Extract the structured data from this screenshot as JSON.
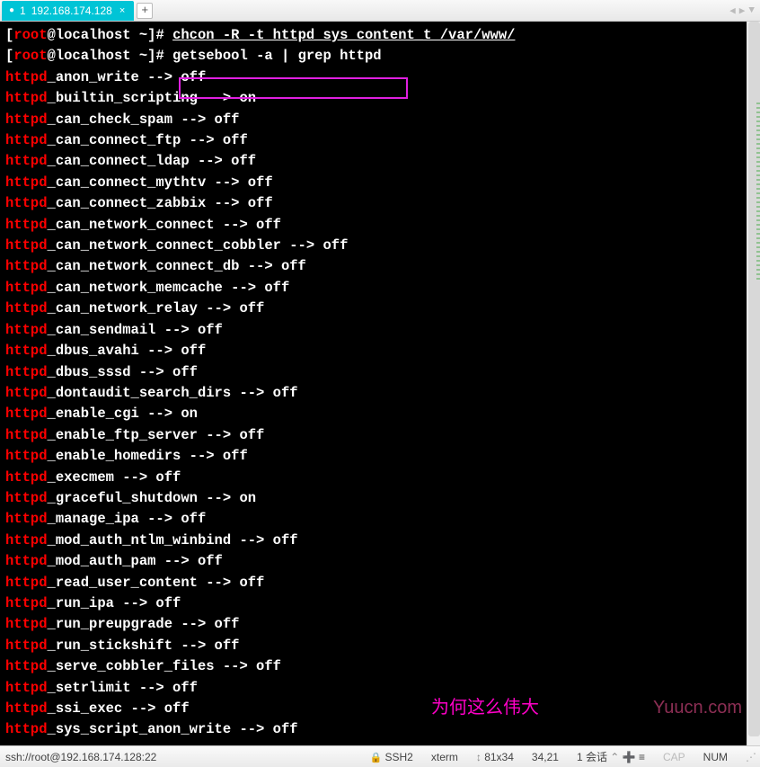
{
  "tab": {
    "index": "1",
    "title": "192.168.174.128",
    "close": "×",
    "add": "+"
  },
  "nav": {
    "left": "◀",
    "right": "▶",
    "down": "▼"
  },
  "prompt": {
    "user": "root",
    "host": "localhost",
    "dir": "~",
    "symbol": "#"
  },
  "cmd1": "chcon -R -t httpd_sys_content_t /var/www/",
  "cmd2": "getsebool -a | grep httpd",
  "booleans": [
    {
      "name": "_anon_write",
      "val": "off"
    },
    {
      "name": "_builtin_scripting",
      "val": "on"
    },
    {
      "name": "_can_check_spam",
      "val": "off"
    },
    {
      "name": "_can_connect_ftp",
      "val": "off"
    },
    {
      "name": "_can_connect_ldap",
      "val": "off"
    },
    {
      "name": "_can_connect_mythtv",
      "val": "off"
    },
    {
      "name": "_can_connect_zabbix",
      "val": "off"
    },
    {
      "name": "_can_network_connect",
      "val": "off"
    },
    {
      "name": "_can_network_connect_cobbler",
      "val": "off"
    },
    {
      "name": "_can_network_connect_db",
      "val": "off"
    },
    {
      "name": "_can_network_memcache",
      "val": "off"
    },
    {
      "name": "_can_network_relay",
      "val": "off"
    },
    {
      "name": "_can_sendmail",
      "val": "off"
    },
    {
      "name": "_dbus_avahi",
      "val": "off"
    },
    {
      "name": "_dbus_sssd",
      "val": "off"
    },
    {
      "name": "_dontaudit_search_dirs",
      "val": "off"
    },
    {
      "name": "_enable_cgi",
      "val": "on"
    },
    {
      "name": "_enable_ftp_server",
      "val": "off"
    },
    {
      "name": "_enable_homedirs",
      "val": "off"
    },
    {
      "name": "_execmem",
      "val": "off"
    },
    {
      "name": "_graceful_shutdown",
      "val": "on"
    },
    {
      "name": "_manage_ipa",
      "val": "off"
    },
    {
      "name": "_mod_auth_ntlm_winbind",
      "val": "off"
    },
    {
      "name": "_mod_auth_pam",
      "val": "off"
    },
    {
      "name": "_read_user_content",
      "val": "off"
    },
    {
      "name": "_run_ipa",
      "val": "off"
    },
    {
      "name": "_run_preupgrade",
      "val": "off"
    },
    {
      "name": "_run_stickshift",
      "val": "off"
    },
    {
      "name": "_serve_cobbler_files",
      "val": "off"
    },
    {
      "name": "_setrlimit",
      "val": "off"
    },
    {
      "name": "_ssi_exec",
      "val": "off"
    },
    {
      "name": "_sys_script_anon_write",
      "val": "off"
    }
  ],
  "hl_prefix": "httpd",
  "arrow": " --> ",
  "watermark1": "为何这么伟大",
  "watermark2": "Yuucn.com",
  "statusbar": {
    "conn": "ssh://root@192.168.174.128:22",
    "ssh": "SSH2",
    "term": "xterm",
    "size": "81x34",
    "cursor": "34,21",
    "sessions": "1 会话",
    "caps": "CAP",
    "num": "NUM"
  }
}
